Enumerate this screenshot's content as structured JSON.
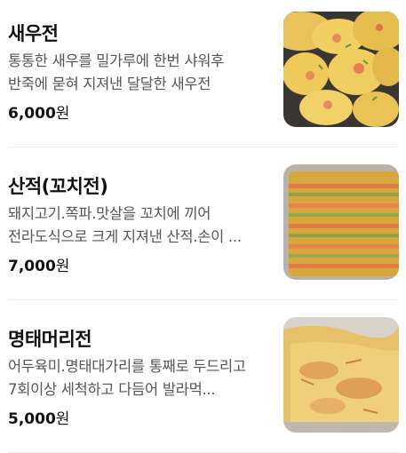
{
  "menu": {
    "items": [
      {
        "name": "새우전",
        "description": "통통한 새우를 밀가루에 한번 샤워후 반죽에 묻혀 지져낸 달달한 새우전",
        "price_amount": "6,000",
        "price_unit": "원",
        "image_icon": "shrimp-pancake-photo"
      },
      {
        "name": "산적(꼬치전)",
        "description": "돼지고기.쪽파.맛살을 꼬치에 끼어 전라도식으로 크게 지져낸 산적.손이 ...",
        "price_amount": "7,000",
        "price_unit": "원",
        "image_icon": "skewer-pancake-photo"
      },
      {
        "name": "명태머리전",
        "description": "어두육미.명태대가리를 통째로 두드리고 7회이상 세척하고 다듬어 발라먹...",
        "price_amount": "5,000",
        "price_unit": "원",
        "image_icon": "pollock-head-pancake-photo"
      }
    ]
  }
}
